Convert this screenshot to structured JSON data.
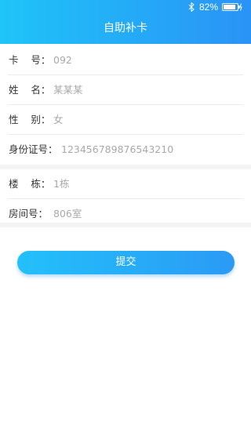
{
  "status_bar": {
    "battery_percent": "82%",
    "icons": [
      "bluetooth-icon",
      "battery-charging-icon"
    ]
  },
  "header": {
    "title": "自助补卡"
  },
  "form": {
    "section1": [
      {
        "label": "卡    号：",
        "value": "092"
      },
      {
        "label": "姓    名：",
        "value": "某某某"
      },
      {
        "label": "性    别：",
        "value": "女"
      },
      {
        "label": "身份证号：",
        "value": "123456789876543210"
      }
    ],
    "section2": [
      {
        "label": "楼    栋：",
        "value": "1栋"
      },
      {
        "label": "房间号：",
        "value": "806室"
      }
    ]
  },
  "submit": {
    "label": "提交"
  },
  "colors": {
    "header_gradient_start": "#1fc4f8",
    "header_gradient_end": "#2a93f6",
    "label_text": "#333333",
    "value_text": "#a9a9a9",
    "separator": "#f4f4f4"
  }
}
